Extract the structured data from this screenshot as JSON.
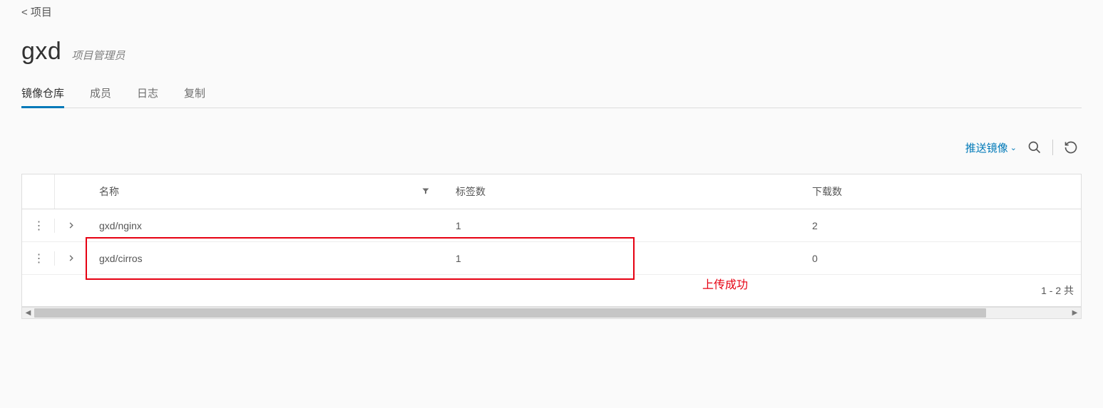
{
  "breadcrumb": "< 项目",
  "title": "gxd",
  "role": "项目管理员",
  "tabs": [
    {
      "label": "镜像仓库",
      "active": true
    },
    {
      "label": "成员",
      "active": false
    },
    {
      "label": "日志",
      "active": false
    },
    {
      "label": "复制",
      "active": false
    }
  ],
  "toolbar": {
    "push_label": "推送镜像"
  },
  "columns": {
    "name": "名称",
    "tags": "标签数",
    "downloads": "下载数"
  },
  "rows": [
    {
      "name": "gxd/nginx",
      "tags": "1",
      "downloads": "2"
    },
    {
      "name": "gxd/cirros",
      "tags": "1",
      "downloads": "0"
    }
  ],
  "annotation": "上传成功",
  "footer_count": "1 - 2 共"
}
